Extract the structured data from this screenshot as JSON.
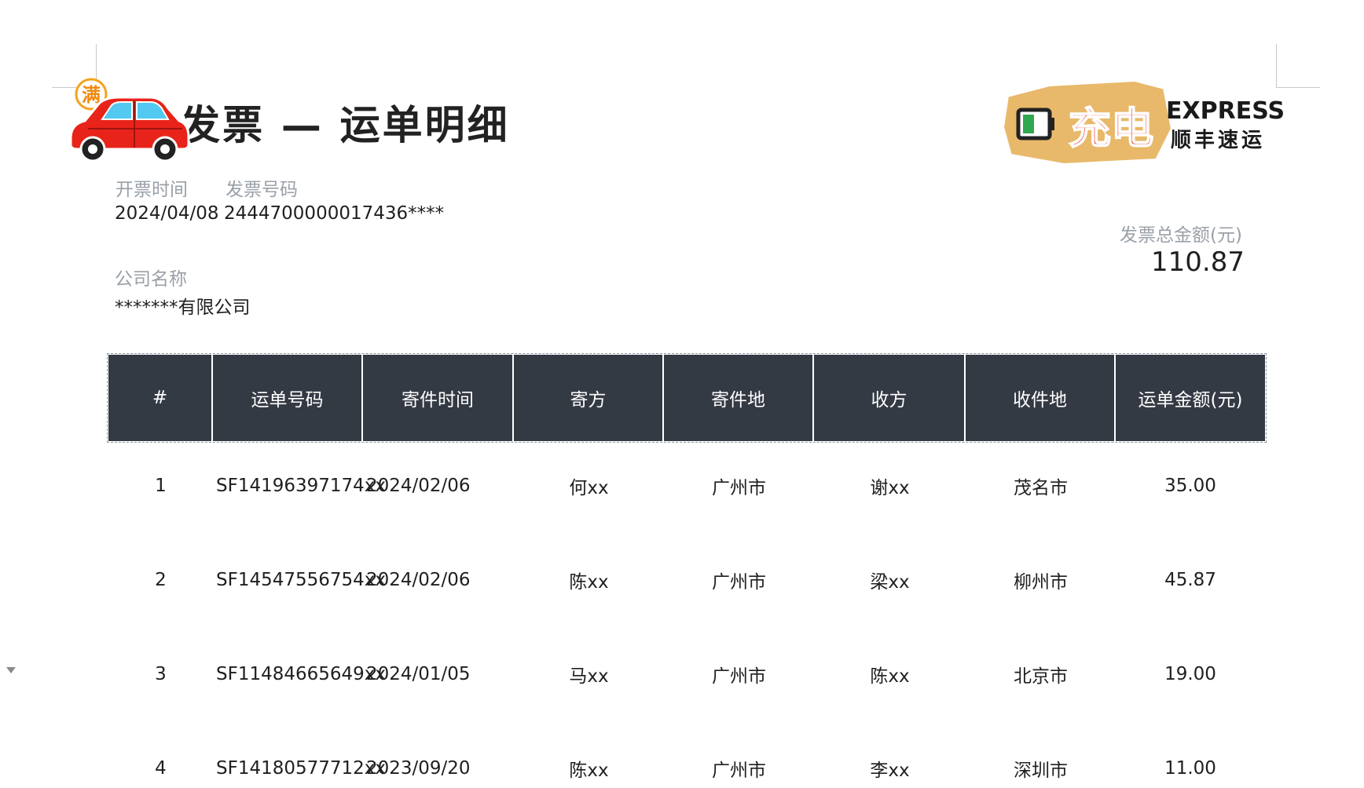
{
  "document": {
    "title": "-发票 — 运单明细",
    "brand": {
      "express": "EXPRESS",
      "cn": "顺丰速运"
    },
    "stickers": {
      "car_text": "满",
      "logo_text": "充电"
    },
    "invoice_time_label": "开票时间",
    "invoice_time_value": "2024/04/08",
    "invoice_no_label": "发票号码",
    "invoice_no_value": "2444700000017436****",
    "company_label": "公司名称",
    "company_value": "*******有限公司",
    "total_label": "发票总金额(元)",
    "total_value": "110.87"
  },
  "table": {
    "headers": [
      "#",
      "运单号码",
      "寄件时间",
      "寄方",
      "寄件地",
      "收方",
      "收件地",
      "运单金额(元)"
    ],
    "rows": [
      [
        "1",
        "SF14196397174xx",
        "2024/02/06",
        "何xx",
        "广州市",
        "谢xx",
        "茂名市",
        "35.00"
      ],
      [
        "2",
        "SF14547556754xx",
        "2024/02/06",
        "陈xx",
        "广州市",
        "梁xx",
        "柳州市",
        "45.87"
      ],
      [
        "3",
        "SF11484665649xx",
        "2024/01/05",
        "马xx",
        "广州市",
        "陈xx",
        "北京市",
        "19.00"
      ],
      [
        "4",
        "SF14180577712xx",
        "2023/09/20",
        "陈xx",
        "广州市",
        "李xx",
        "深圳市",
        "11.00"
      ]
    ]
  },
  "colors": {
    "header_bg": "#343a44",
    "label_gray": "#9aa0a8",
    "sticker_red": "#e8231a",
    "sticker_tan": "#e8b96a"
  }
}
